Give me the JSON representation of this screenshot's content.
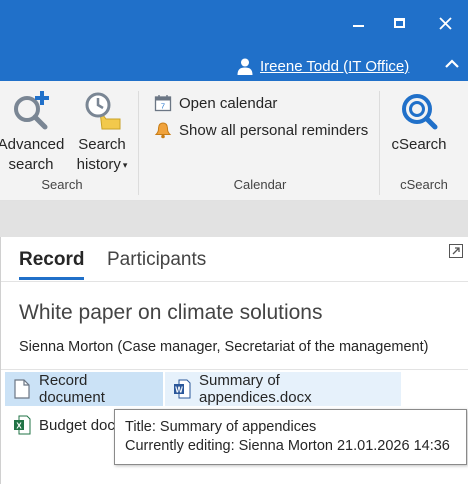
{
  "window": {
    "controls": {
      "minimize": "minimize-icon",
      "maximize": "maximize-icon",
      "close": "close-icon"
    },
    "user": {
      "name": "Ireene Todd (IT Office)",
      "icon": "user-icon"
    },
    "collapse_icon": "chevron-up-icon"
  },
  "ribbon": {
    "search_group": {
      "label": "Search",
      "advanced_search": {
        "line1": "Advanced",
        "line2": "search",
        "icon": "magnifier-plus-icon"
      },
      "search_history": {
        "line1": "Search",
        "line2": "history",
        "icon": "clock-history-icon",
        "caret": "▾"
      }
    },
    "calendar_group": {
      "label": "Calendar",
      "open_calendar": {
        "label": "Open calendar",
        "icon": "calendar-icon"
      },
      "show_reminders": {
        "label": "Show all personal reminders",
        "icon": "bell-icon"
      }
    },
    "csearch_group": {
      "label": "cSearch",
      "csearch": {
        "label": "cSearch",
        "icon": "csearch-magnifier-icon"
      }
    }
  },
  "detail": {
    "popout_icon": "popout-icon",
    "tabs": [
      {
        "label": "Record",
        "active": true
      },
      {
        "label": "Participants",
        "active": false
      }
    ],
    "title": "White paper on climate solutions",
    "subtitle": "Sienna Morton (Case manager, Secretariat of the management)",
    "documents": [
      {
        "label": "Record document",
        "icon": "blank-document-icon",
        "selected": true
      },
      {
        "label": "Summary of appendices.docx",
        "icon": "word-document-icon",
        "hovered": true
      },
      {
        "label": "Budget doc",
        "icon": "excel-document-icon"
      }
    ],
    "tooltip": {
      "title_line": "Title: Summary of appendices",
      "editing_line": "Currently editing: Sienna Morton 21.01.2026 14:36"
    }
  },
  "colors": {
    "titlebar": "#2070c9",
    "ribbon_bg": "#f3f3f3",
    "selected_chip": "#cbe2f6",
    "hover_chip": "#e6f1fb",
    "word_blue": "#2b579a",
    "excel_green": "#217346"
  }
}
